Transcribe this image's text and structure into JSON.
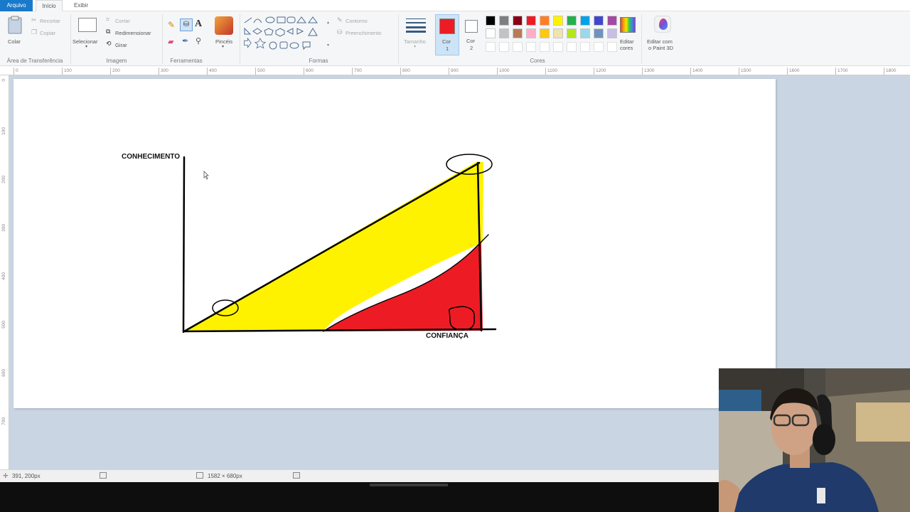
{
  "tabs": {
    "arquivo": "Arquivo",
    "inicio": "Início",
    "exibir": "Exibir"
  },
  "clipboard": {
    "paste": "Colar",
    "cut": "Recortar",
    "copy": "Copiar",
    "group": "Área de Transferência"
  },
  "image": {
    "select": "Selecionar",
    "crop": "Cortar",
    "resize": "Redimensionar",
    "rotate": "Girar",
    "group": "Imagem"
  },
  "tools": {
    "group": "Ferramentas",
    "brushes": "Pincéis"
  },
  "shapes": {
    "outline": "Contorno",
    "fill": "Preenchimento",
    "group": "Formas"
  },
  "size": {
    "label": "Tamanho"
  },
  "colors": {
    "color1_label": "Cor",
    "color1_num": "1",
    "color2_label": "Cor",
    "color2_num": "2",
    "color1": "#ed1c24",
    "color2": "#ffffff",
    "edit_line1": "Editar",
    "edit_line2": "cores",
    "paint3d_line1": "Editar com",
    "paint3d_line2": "o Paint 3D",
    "group": "Cores",
    "palette_row1": [
      "#000000",
      "#7f7f7f",
      "#880015",
      "#ed1c24",
      "#ff7f27",
      "#fff200",
      "#22b14c",
      "#00a2e8",
      "#3f48cc",
      "#a349a4"
    ],
    "palette_row2": [
      "#ffffff",
      "#c3c3c3",
      "#b97a57",
      "#ffaec9",
      "#ffc90e",
      "#efe4b0",
      "#b5e61d",
      "#99d9ea",
      "#7092be",
      "#c8bfe7"
    ]
  },
  "ruler": {
    "h": [
      "0",
      "100",
      "200",
      "300",
      "400",
      "500",
      "600",
      "700",
      "800",
      "900",
      "1000",
      "1100",
      "1200",
      "1300",
      "1400",
      "1500",
      "1600",
      "1700",
      "1800"
    ],
    "v": [
      "0",
      "100",
      "200",
      "300",
      "400",
      "500",
      "600",
      "700"
    ]
  },
  "drawing": {
    "y_label": "CONHECIMENTO",
    "x_label": "CONFIANÇA",
    "upper_fill": "#fff200",
    "lower_fill": "#ed1c24",
    "stroke": "#000000"
  },
  "status": {
    "cursor_pos": "391, 200px",
    "canvas_size": "1582 × 680px"
  }
}
